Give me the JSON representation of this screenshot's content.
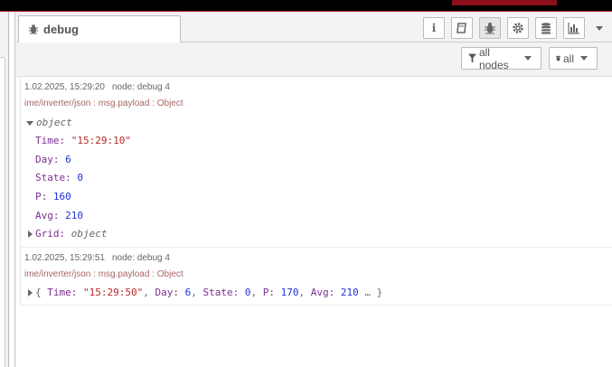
{
  "sidebar": {
    "tab_label": "debug",
    "tab_icon": "bug-icon",
    "buttons": [
      {
        "name": "info-tab-button",
        "icon": "info-icon",
        "glyph": "i"
      },
      {
        "name": "help-tab-button",
        "icon": "book-icon"
      },
      {
        "name": "debug-tab-button",
        "icon": "bug-icon",
        "active": true
      },
      {
        "name": "config-tab-button",
        "icon": "gear-icon"
      },
      {
        "name": "context-tab-button",
        "icon": "database-icon"
      },
      {
        "name": "dashboard-tab-button",
        "icon": "bar-chart-icon"
      }
    ]
  },
  "filters": {
    "nodes_label": "all nodes",
    "clear_label": "all"
  },
  "messages": [
    {
      "timestamp": "1.02.2025, 15:29:20",
      "node": "node: debug 4",
      "topic": "ime/inverter/json : msg.payload : Object",
      "root_type": "object",
      "fields": [
        {
          "key": "Time:",
          "value": "\"15:29:10\"",
          "kind": "str"
        },
        {
          "key": "Day:",
          "value": "6",
          "kind": "num"
        },
        {
          "key": "State:",
          "value": "0",
          "kind": "num"
        },
        {
          "key": "P:",
          "value": "160",
          "kind": "num"
        },
        {
          "key": "Avg:",
          "value": "210",
          "kind": "num"
        }
      ],
      "collapsed_child": {
        "key": "Grid:",
        "value": "object"
      }
    },
    {
      "timestamp": "1.02.2025, 15:29:51",
      "node": "node: debug 4",
      "topic": "ime/inverter/json : msg.payload : Object",
      "summary": {
        "open": "{",
        "time_key": "Time:",
        "time_val": "\"15:29:50\"",
        "day_key": "Day:",
        "day_val": "6",
        "state_key": "State:",
        "state_val": "0",
        "p_key": "P:",
        "p_val": "170",
        "avg_key": "Avg:",
        "avg_val": "210",
        "close": "… }"
      }
    }
  ]
}
